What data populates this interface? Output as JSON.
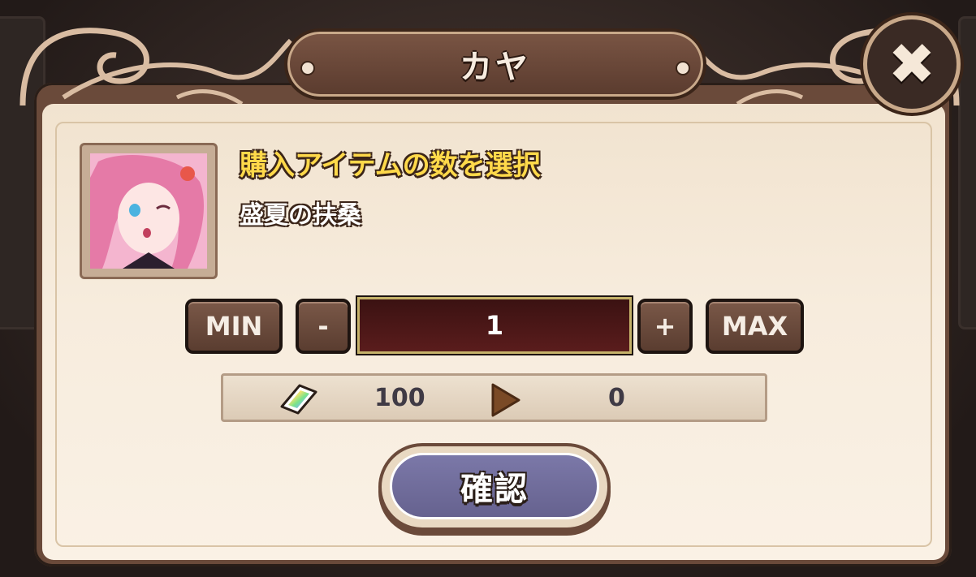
{
  "dialog": {
    "title": "カヤ",
    "close_label": "✖"
  },
  "item": {
    "heading": "購入アイテムの数を選択",
    "name": "盛夏の扶桑"
  },
  "quantity": {
    "min_label": "MIN",
    "minus_label": "-",
    "value": "1",
    "plus_label": "+",
    "max_label": "MAX"
  },
  "cost": {
    "current": "100",
    "after": "0"
  },
  "confirm": {
    "label": "確認"
  },
  "colors": {
    "accent_yellow": "#ffd94a",
    "panel": "#f7ecdd",
    "button_brown": "#5a3d30",
    "confirm_purple": "#6f6b9b",
    "quantity_field": "#4a1818"
  }
}
